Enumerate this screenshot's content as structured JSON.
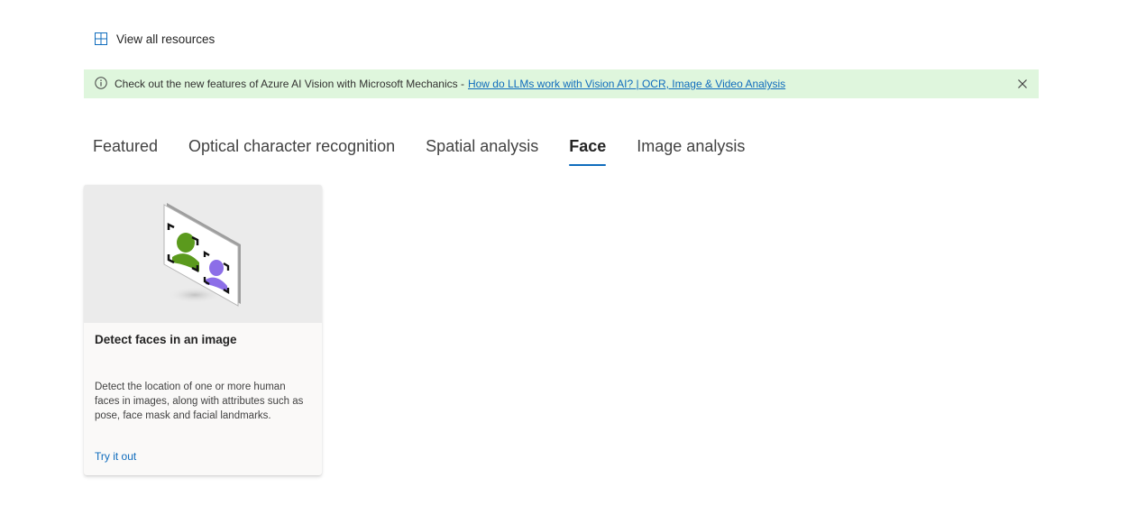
{
  "header": {
    "view_all_label": "View all resources",
    "view_all_icon": "grid-icon"
  },
  "banner": {
    "text": "Check out the new features of Azure AI Vision with Microsoft Mechanics -",
    "link_text": "How do LLMs work with Vision AI? | OCR, Image & Video Analysis",
    "background": "#dff6dd",
    "info_icon": "info-icon",
    "close_icon": "close-icon"
  },
  "tabs": [
    {
      "label": "Featured",
      "active": false
    },
    {
      "label": "Optical character recognition",
      "active": false
    },
    {
      "label": "Spatial analysis",
      "active": false
    },
    {
      "label": "Face",
      "active": true
    },
    {
      "label": "Image analysis",
      "active": false
    }
  ],
  "cards": [
    {
      "title": "Detect faces in an image",
      "description": "Detect the location of one or more human faces in images, along with attributes such as pose, face mask and facial landmarks.",
      "action_label": "Try it out",
      "illustration": "face-detection-illustration"
    }
  ],
  "colors": {
    "accent": "#0f6cbd",
    "banner_bg": "#dff6dd",
    "card_bg": "#faf9f8",
    "thumb_bg": "#ebebeb"
  }
}
